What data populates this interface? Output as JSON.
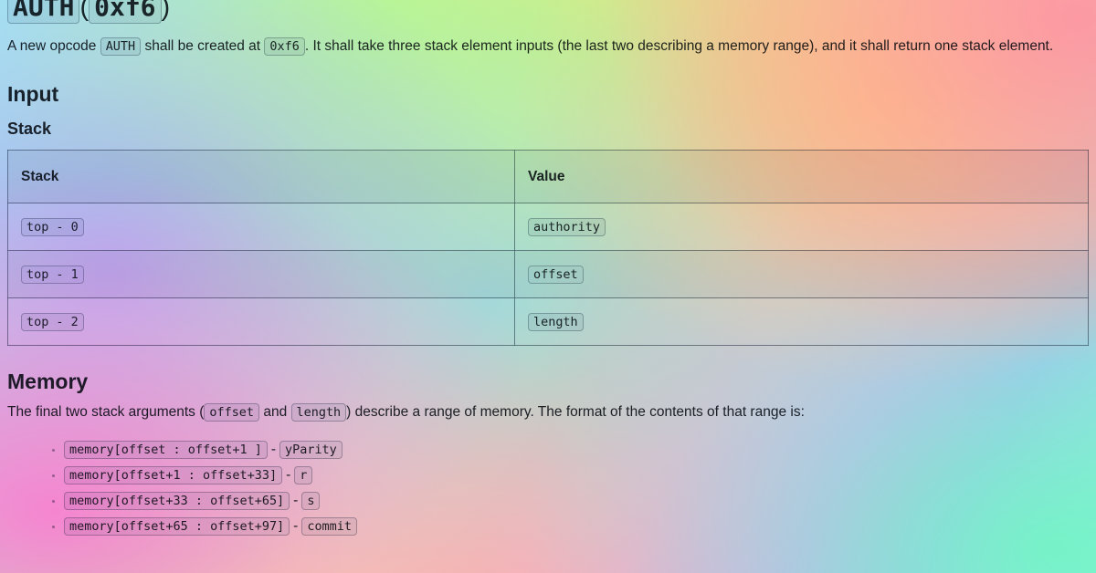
{
  "document": {
    "title_code": "AUTH",
    "title_paren_open": "(",
    "title_opcode": "0xf6",
    "title_paren_close": ")",
    "intro": {
      "part1": "A new opcode ",
      "code1": "AUTH",
      "part2": " shall be created at ",
      "code2": "0xf6",
      "part3": ". It shall take three stack element inputs (the last two describing a memory range), and it shall return one stack element."
    },
    "sections": {
      "input_heading": "Input",
      "stack_subheading": "Stack",
      "memory_heading": "Memory"
    },
    "stack_table": {
      "headers": [
        "Stack",
        "Value"
      ],
      "rows": [
        {
          "stack": "top - 0",
          "value": "authority"
        },
        {
          "stack": "top - 1",
          "value": "offset"
        },
        {
          "stack": "top - 2",
          "value": "length"
        }
      ]
    },
    "memory": {
      "para_part1": "The final two stack arguments (",
      "para_code1": "offset",
      "para_part2": " and ",
      "para_code2": "length",
      "para_part3": ") describe a range of memory. The format of the contents of that range is:",
      "items": [
        {
          "range": "memory[offset : offset+1 ]",
          "dash": "-",
          "label": "yParity"
        },
        {
          "range": "memory[offset+1 : offset+33]",
          "dash": "-",
          "label": "r"
        },
        {
          "range": "memory[offset+33 : offset+65]",
          "dash": "-",
          "label": "s"
        },
        {
          "range": "memory[offset+65 : offset+97]",
          "dash": "-",
          "label": "commit"
        }
      ]
    }
  },
  "colors": {
    "text": "#24292f",
    "code_bg": "#ebeef2",
    "table_border": "#646e7d"
  }
}
